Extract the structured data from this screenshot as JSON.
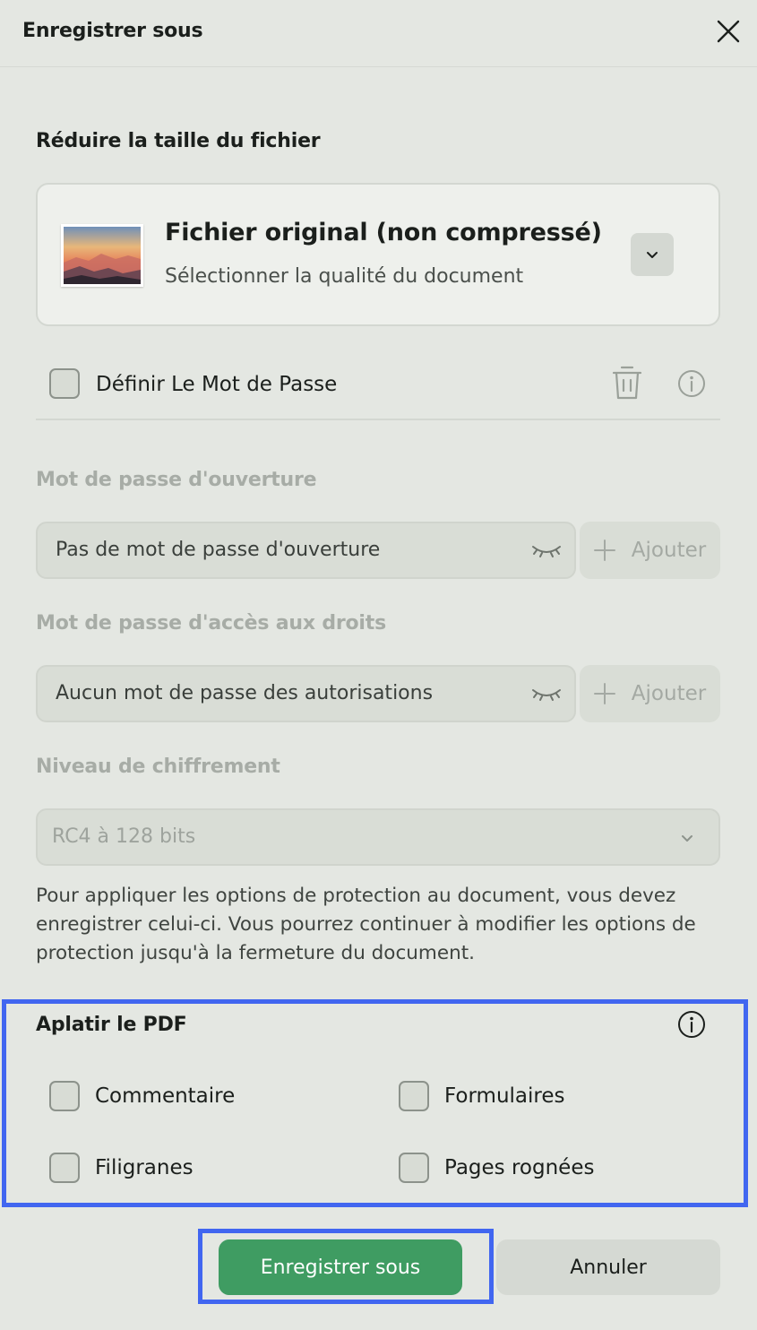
{
  "header": {
    "title": "Enregistrer sous"
  },
  "compression": {
    "section_title": "Réduire la taille du fichier",
    "option_title": "Fichier original (non compressé)",
    "option_subtitle": "Sélectionner la qualité du document"
  },
  "password": {
    "checkbox_label": "Définir Le Mot de Passe",
    "open_password_title": "Mot de passe d'ouverture",
    "open_password_value": "Pas de mot de passe d'ouverture",
    "permissions_title": "Mot de passe d'accès aux droits",
    "permissions_value": "Aucun mot de passe des autorisations",
    "add_label": "Ajouter",
    "encryption_title": "Niveau de chiffrement",
    "encryption_value": "RC4 à 128 bits",
    "note": "Pour appliquer les options de protection au document, vous devez enregistrer celui-ci. Vous pourrez continuer à modifier les options de protection jusqu'à la fermeture du document."
  },
  "flatten": {
    "title": "Aplatir le PDF",
    "options": [
      "Commentaire",
      "Formulaires",
      "Filigranes",
      "Pages rognées"
    ]
  },
  "actions": {
    "save": "Enregistrer sous",
    "cancel": "Annuler"
  },
  "colors": {
    "accent": "#3f9c62",
    "highlight": "#4166f0",
    "background": "#e4e7e2"
  }
}
